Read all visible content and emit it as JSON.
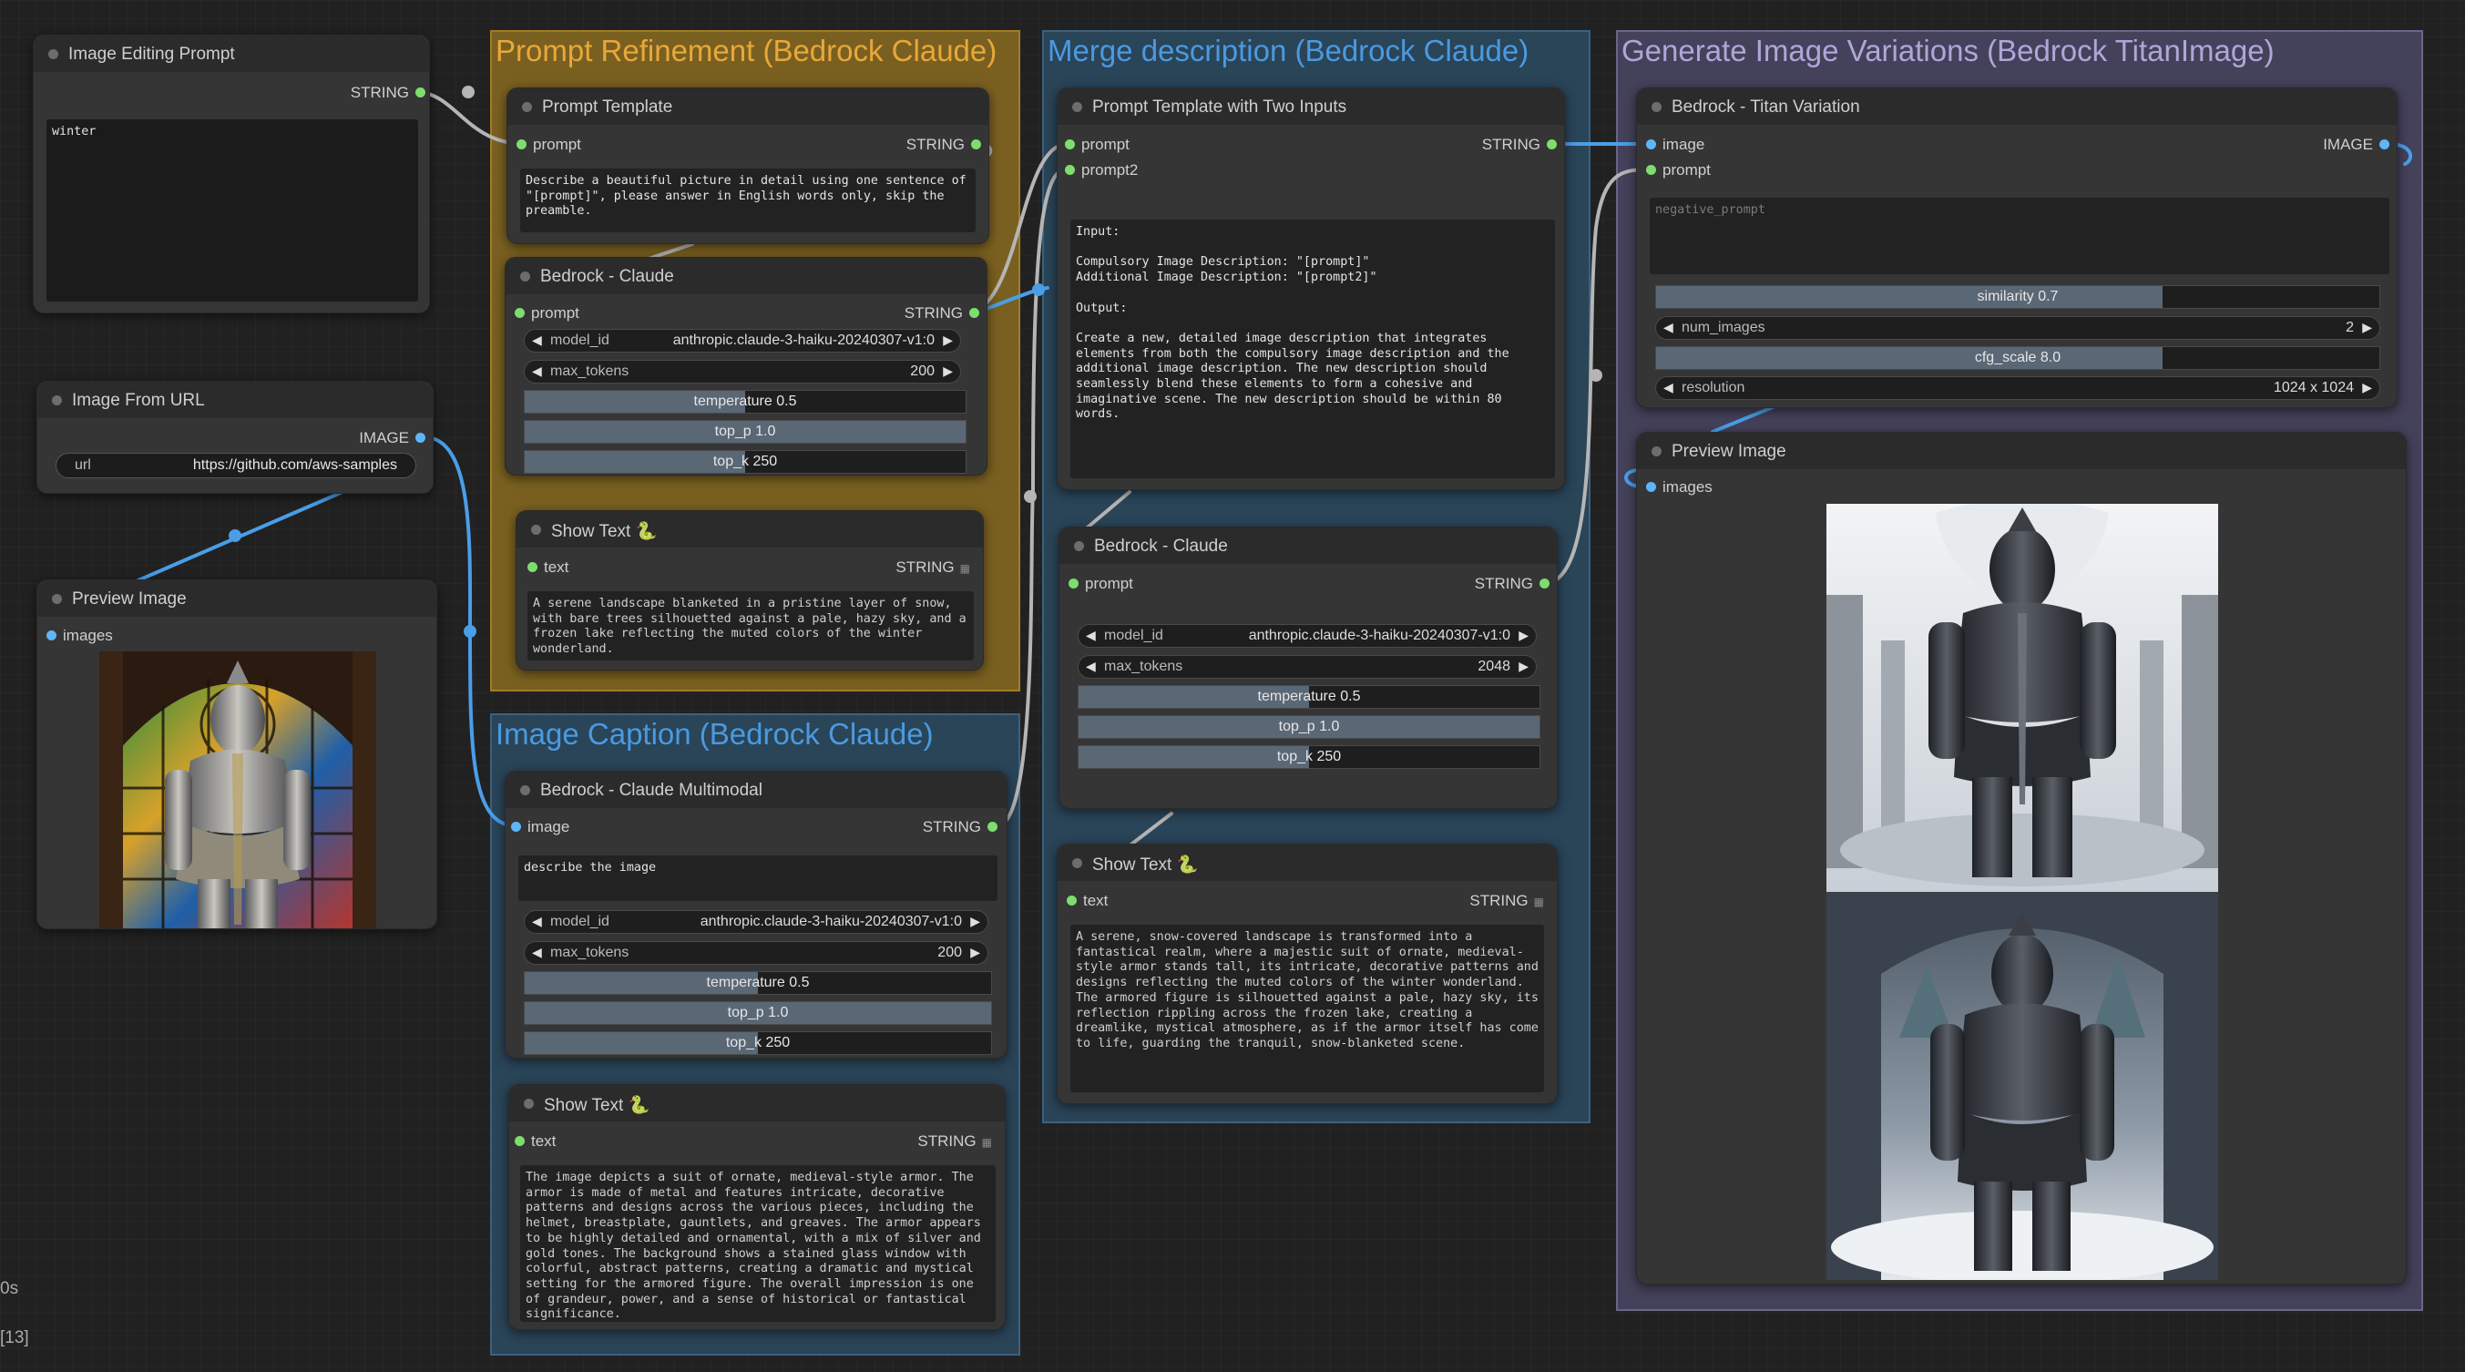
{
  "groups": {
    "refine": {
      "title": "Prompt Refinement (Bedrock Claude)"
    },
    "caption": {
      "title": "Image Caption (Bedrock Claude)"
    },
    "merge": {
      "title": "Merge description (Bedrock Claude)"
    },
    "generate": {
      "title": "Generate Image Variations (Bedrock TitanImage)"
    }
  },
  "nodes": {
    "editing_prompt": {
      "title": "Image Editing Prompt",
      "out": "STRING",
      "text": "winter"
    },
    "image_url": {
      "title": "Image From URL",
      "out": "IMAGE",
      "url_label": "url",
      "url_value": "https://github.com/aws-samples"
    },
    "preview_left": {
      "title": "Preview Image",
      "in": "images"
    },
    "prompt_template": {
      "title": "Prompt Template",
      "in": "prompt",
      "out": "STRING",
      "text": "Describe a beautiful picture in detail using one sentence of \"[prompt]\", please answer in English words only, skip the preamble."
    },
    "claude_refine": {
      "title": "Bedrock - Claude",
      "in": "prompt",
      "out": "STRING",
      "model_label": "model_id",
      "model": "anthropic.claude-3-haiku-20240307-v1:0",
      "max_tokens_label": "max_tokens",
      "max_tokens": "200",
      "temperature": "temperature  0.5",
      "top_p": "top_p  1.0",
      "top_k": "top_k  250"
    },
    "show_text_refine": {
      "title": "Show Text 🐍",
      "in": "text",
      "out": "STRING",
      "text": "A serene landscape blanketed in a pristine layer of snow, with bare trees silhouetted against a pale, hazy sky, and a frozen lake reflecting the muted colors of the winter wonderland."
    },
    "claude_multimodal": {
      "title": "Bedrock - Claude Multimodal",
      "in": "image",
      "out": "STRING",
      "prompt_text": "describe the image",
      "model_label": "model_id",
      "model": "anthropic.claude-3-haiku-20240307-v1:0",
      "max_tokens_label": "max_tokens",
      "max_tokens": "200",
      "temperature": "temperature  0.5",
      "top_p": "top_p  1.0",
      "top_k": "top_k  250"
    },
    "show_text_caption": {
      "title": "Show Text 🐍",
      "in": "text",
      "out": "STRING",
      "text": "The image depicts a suit of ornate, medieval-style armor. The armor is made of metal and features intricate, decorative patterns and designs across the various pieces, including the helmet, breastplate, gauntlets, and greaves. The armor appears to be highly detailed and ornamental, with a mix of silver and gold tones. The background shows a stained glass window with colorful, abstract patterns, creating a dramatic and mystical setting for the armored figure. The overall impression is one of grandeur, power, and a sense of historical or fantastical significance."
    },
    "template_two": {
      "title": "Prompt Template with Two Inputs",
      "in1": "prompt",
      "in2": "prompt2",
      "out": "STRING",
      "text": "Input:\n\nCompulsory Image Description: \"[prompt]\"\nAdditional Image Description: \"[prompt2]\"\n\nOutput:\n\nCreate a new, detailed image description that integrates elements from both the compulsory image description and the additional image description. The new description should seamlessly blend these elements to form a cohesive and imaginative scene. The new description should be within 80 words."
    },
    "claude_merge": {
      "title": "Bedrock - Claude",
      "in": "prompt",
      "out": "STRING",
      "model_label": "model_id",
      "model": "anthropic.claude-3-haiku-20240307-v1:0",
      "max_tokens_label": "max_tokens",
      "max_tokens": "2048",
      "temperature": "temperature  0.5",
      "top_p": "top_p  1.0",
      "top_k": "top_k  250"
    },
    "show_text_merge": {
      "title": "Show Text 🐍",
      "in": "text",
      "out": "STRING",
      "text": "A serene, snow-covered landscape is transformed into a fantastical realm, where a majestic suit of ornate, medieval-style armor stands tall, its intricate, decorative patterns and designs reflecting the muted colors of the winter wonderland. The armored figure is silhouetted against a pale, hazy sky, its reflection rippling across the frozen lake, creating a dreamlike, mystical atmosphere, as if the armor itself has come to life, guarding the tranquil, snow-blanketed scene."
    },
    "titan": {
      "title": "Bedrock - Titan Variation",
      "in1": "image",
      "in2": "prompt",
      "out": "IMAGE",
      "negative_placeholder": "negative_prompt",
      "similarity": "similarity  0.7",
      "similarity_level": 0.7,
      "num_images_label": "num_images",
      "num_images": "2",
      "cfg_scale": "cfg_scale  8.0",
      "resolution_label": "resolution",
      "resolution": "1024 x 1024"
    },
    "preview_right": {
      "title": "Preview Image",
      "in": "images"
    }
  },
  "sidebar_fragments": {
    "a": "0s",
    "b": "[13]"
  },
  "colors": {
    "string_port": "#7dde6d",
    "image_port": "#5fb6f7",
    "wire_image": "#4a9ee8",
    "wire_string": "#b5b5b5"
  }
}
